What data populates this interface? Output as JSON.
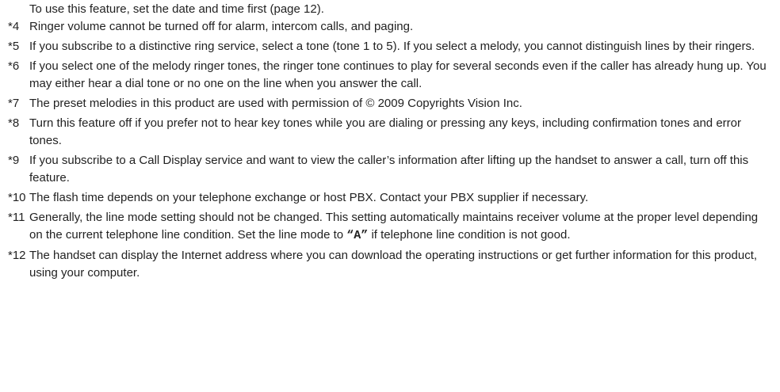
{
  "intro": "To use this feature, set the date and time first (page 12).",
  "notes": [
    {
      "mark": "*4",
      "text": "Ringer volume cannot be turned off for alarm, intercom calls, and paging."
    },
    {
      "mark": "*5",
      "text": "If you subscribe to a distinctive ring service, select a tone (tone 1 to 5). If you select a melody, you cannot distinguish lines by their ringers."
    },
    {
      "mark": "*6",
      "text": "If you select one of the melody ringer tones, the ringer tone continues to play for several seconds even if the caller has already hung up. You may either hear a dial tone or no one on the line when you answer the call."
    },
    {
      "mark": "*7",
      "text": "The preset melodies in this product are used with permission of © 2009 Copyrights Vision Inc."
    },
    {
      "mark": "*8",
      "text": "Turn this feature off if you prefer not to hear key tones while you are dialing or pressing any keys, including confirmation tones and error tones."
    },
    {
      "mark": "*9",
      "text": "If you subscribe to a Call Display service and want to view the caller’s information after lifting up the handset to answer a call, turn off this feature."
    },
    {
      "mark": "*10",
      "text": "The flash time depends on your telephone exchange or host PBX. Contact your PBX supplier if necessary."
    },
    {
      "mark": "*11",
      "text_before": "Generally, the line mode setting should not be changed. This setting automatically maintains receiver volume at the proper level depending on the current telephone line condition. Set the line mode to ",
      "mode": "“A”",
      "text_after": " if telephone line condition is not good."
    },
    {
      "mark": "*12",
      "text": "The handset can display the Internet address where you can download the operating instructions or get further information for this product, using your computer."
    }
  ]
}
